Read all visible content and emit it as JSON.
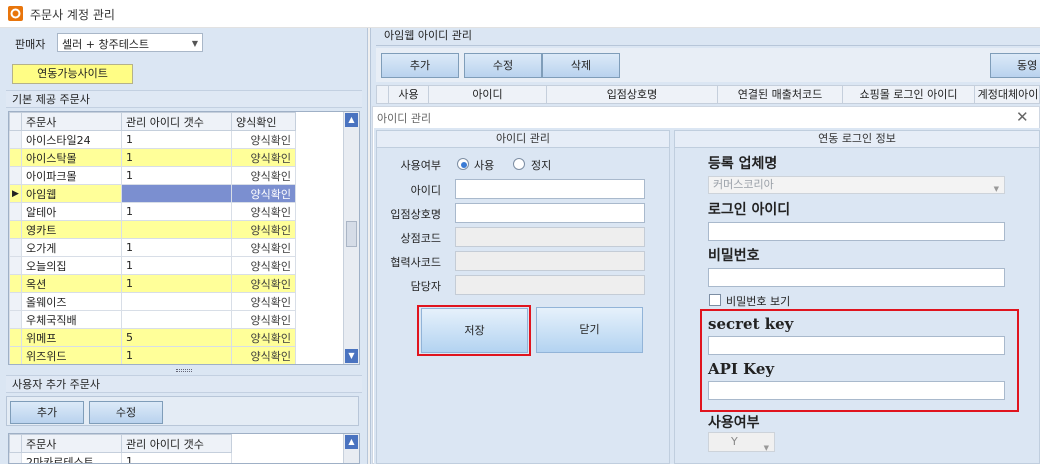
{
  "window": {
    "title": "주문사 계정 관리"
  },
  "seller": {
    "label": "판매자",
    "value": "셀러 + 창주테스트"
  },
  "linked_sites_button": "연동가능사이트",
  "default_malls": {
    "section_title": "기본 제공 주문사",
    "columns": [
      "주문사",
      "관리 아이디 갯수",
      "양식확인"
    ],
    "rows": [
      {
        "name": "아이스타일24",
        "count": "1",
        "status": "양식확인",
        "highlight": false,
        "selected": false
      },
      {
        "name": "아이스탁몰",
        "count": "1",
        "status": "양식확인",
        "highlight": true,
        "selected": false
      },
      {
        "name": "아이파크몰",
        "count": "1",
        "status": "양식확인",
        "highlight": false,
        "selected": false
      },
      {
        "name": "아임웹",
        "count": "",
        "status": "양식확인",
        "highlight": true,
        "selected": true
      },
      {
        "name": "알테아",
        "count": "1",
        "status": "양식확인",
        "highlight": false,
        "selected": false
      },
      {
        "name": "영카트",
        "count": "",
        "status": "양식확인",
        "highlight": true,
        "selected": false
      },
      {
        "name": "오가게",
        "count": "1",
        "status": "양식확인",
        "highlight": false,
        "selected": false
      },
      {
        "name": "오늘의집",
        "count": "1",
        "status": "양식확인",
        "highlight": false,
        "selected": false
      },
      {
        "name": "옥션",
        "count": "1",
        "status": "양식확인",
        "highlight": true,
        "selected": false
      },
      {
        "name": "올웨이즈",
        "count": "",
        "status": "양식확인",
        "highlight": false,
        "selected": false
      },
      {
        "name": "우체국직배",
        "count": "",
        "status": "양식확인",
        "highlight": false,
        "selected": false
      },
      {
        "name": "위메프",
        "count": "5",
        "status": "양식확인",
        "highlight": true,
        "selected": false
      },
      {
        "name": "위즈위드",
        "count": "1",
        "status": "양식확인",
        "highlight": true,
        "selected": false
      }
    ]
  },
  "user_malls": {
    "section_title": "사용자 추가 주문사",
    "add_button": "추가",
    "edit_button": "수정",
    "columns": [
      "주문사",
      "관리 아이디 갯수"
    ],
    "rows": [
      {
        "name": "2마카로테스트",
        "count": "1"
      }
    ]
  },
  "aimweb": {
    "section_title": "아임웹 아이디 관리",
    "add_button": "추가",
    "edit_button": "수정",
    "delete_button": "삭제",
    "sync_button": "동영",
    "columns": [
      "사용",
      "아이디",
      "입점상호명",
      "연결된 매출처코드",
      "쇼핑몰 로그인 아이디",
      "계정대체아이"
    ]
  },
  "dialog": {
    "title": "아이디 관리",
    "account_group": {
      "title": "아이디 관리",
      "use_label": "사용여부",
      "use_option_on": "사용",
      "use_option_off": "정지",
      "id_label": "아이디",
      "store_name_label": "입점상호명",
      "store_code_label": "상점코드",
      "partner_code_label": "협력사코드",
      "manager_label": "담당자",
      "save_button": "저장",
      "close_button": "닫기"
    },
    "link_group": {
      "title": "연동 로그인 정보",
      "company_label": "등록 업체명",
      "company_value": "커머스코리아",
      "login_id_label": "로그인 아이디",
      "password_label": "비밀번호",
      "show_password_label": "비밀번호 보기",
      "secret_key_label": "secret key",
      "api_key_label": "API Key",
      "use_label": "사용여부",
      "use_value": "Y"
    }
  },
  "colors": {
    "highlight_row": "#ffff99",
    "selected_cell": "#7b8fd0",
    "annotation_red": "#e0141e",
    "button_yellow": "#fffd85"
  }
}
